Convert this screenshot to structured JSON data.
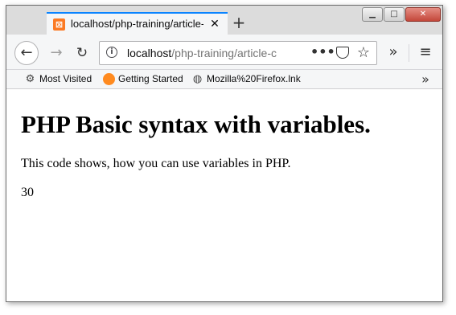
{
  "browser": {
    "tab": {
      "title": "localhost/php-training/article-c",
      "favicon": "xampp-icon",
      "close_glyph": "✕"
    },
    "new_tab_glyph": "+",
    "window_controls": {
      "minimize": "▁",
      "maximize": "□",
      "close": "✕"
    },
    "nav": {
      "back": "←",
      "forward": "→",
      "reload": "↻"
    },
    "url": {
      "host": "localhost",
      "path": "/php-training/article-c"
    },
    "page_actions": {
      "more": "•••",
      "pocket": "♥",
      "bookmark": "☆"
    },
    "overflow": "»",
    "menu": "≡",
    "bookmarks": [
      {
        "label": "Most Visited",
        "icon": "gear-icon",
        "glyph": "⚙"
      },
      {
        "label": "Getting Started",
        "icon": "firefox-icon",
        "glyph": "●"
      },
      {
        "label": "Mozilla%20Firefox.lnk",
        "icon": "globe-icon",
        "glyph": "🌐"
      }
    ],
    "bookmarks_more": "»",
    "colors": {
      "tab_accent": "#0a84ff",
      "favicon": "#fb7a24"
    }
  },
  "page": {
    "heading": "PHP Basic syntax with variables.",
    "paragraph": "This code shows, how you can use variables in PHP.",
    "output": "30"
  }
}
